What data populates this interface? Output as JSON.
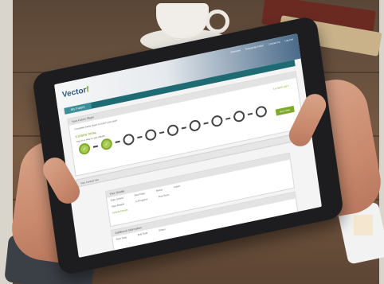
{
  "app": {
    "logo_text": "Vector",
    "logo_mark": "f",
    "nav": [
      "Welcome",
      "Frequently Asked",
      "Contact Us",
      "Log Out"
    ],
    "title_tab": "My Future"
  },
  "progress": {
    "card_title": "Your Future Steps",
    "intro_text": "Complete these steps to reach your goal",
    "status_text": "5 STEPS TOTAL",
    "status_sub": "Tap on a step to see details",
    "right_label": "3 STEPS LEFT",
    "steps_done": 2,
    "steps_total": 9,
    "next_label": "Next Step"
  },
  "collapsible": {
    "label": "Your Contact Info"
  },
  "detail": {
    "header": "Your Details",
    "row1": [
      "Date Joined",
      "Start Date",
      "Status",
      "Active"
    ],
    "row2": [
      "View Details",
      "In Progress",
      "Due Soon"
    ],
    "link": "Update Details"
  },
  "detail2": {
    "header": "Additional Information",
    "row1": [
      "Start Date",
      "End Date",
      "Status"
    ]
  },
  "colors": {
    "brand_teal": "#1f6b74",
    "brand_green": "#7eaa2a"
  }
}
